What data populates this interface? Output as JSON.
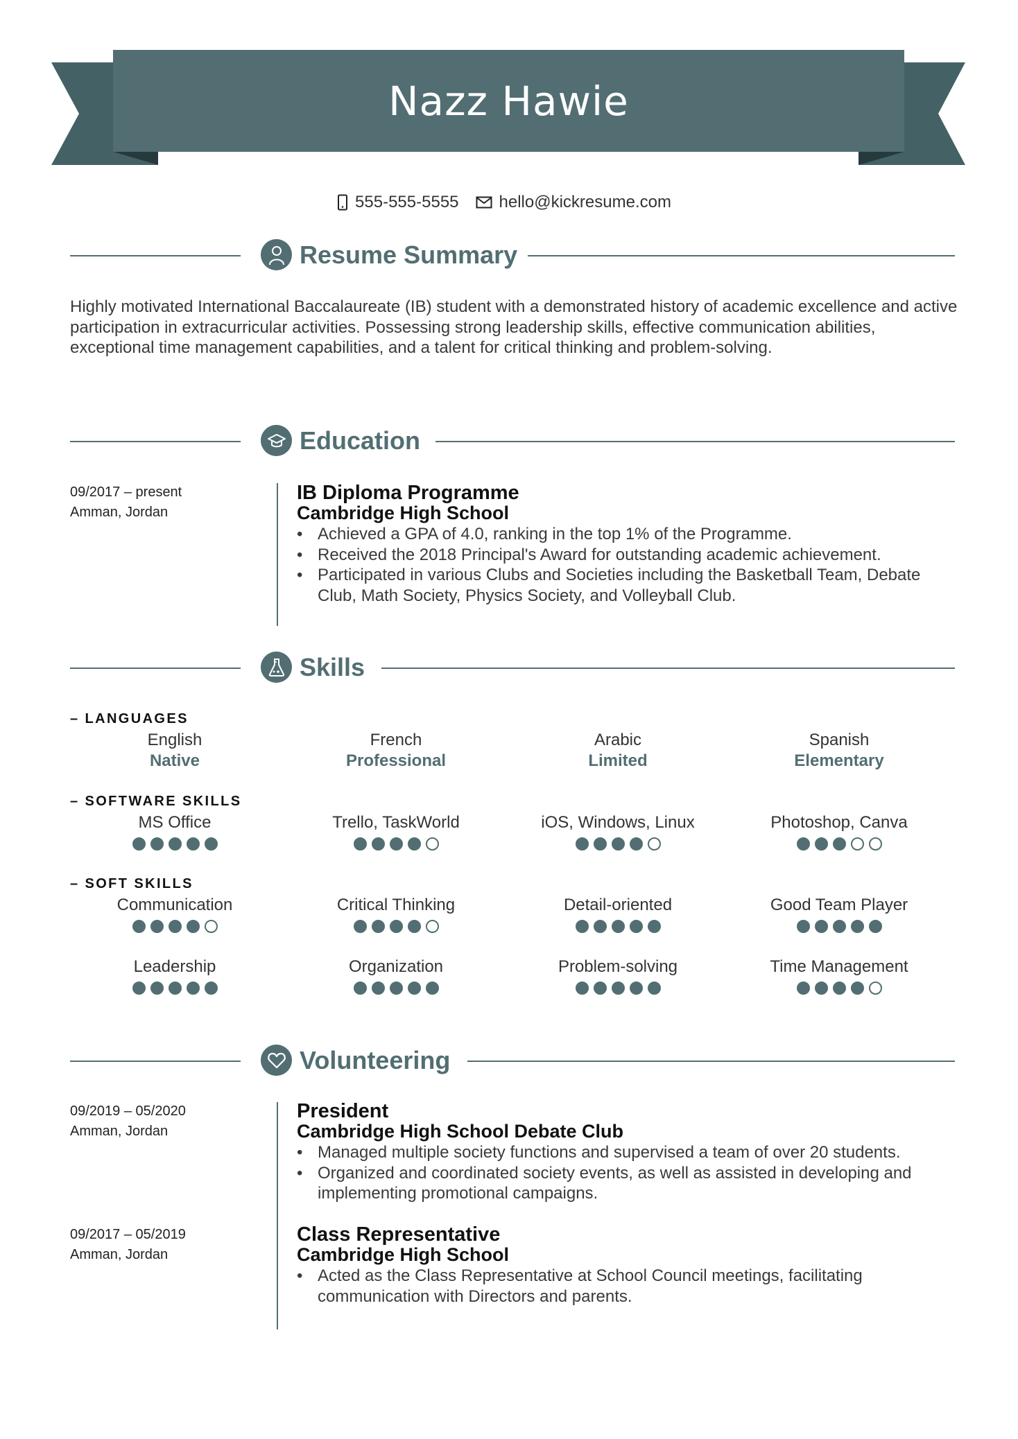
{
  "header": {
    "name": "Nazz Hawie",
    "phone_icon": "phone-icon",
    "phone": "555-555-5555",
    "email_icon": "mail-icon",
    "email": "hello@kickresume.com"
  },
  "colors": {
    "accent": "#526e72",
    "ribbon_tail": "#446266",
    "ribbon_fold": "#263a3d",
    "text": "#333333",
    "heading_text": "#111111"
  },
  "summary": {
    "title": "Resume Summary",
    "icon": "user-icon",
    "text": "Highly motivated International Baccalaureate (IB) student with a demonstrated history of academic excellence and active participation in extracurricular activities. Possessing strong leadership skills, effective communication abilities, exceptional time management capabilities, and a talent for critical thinking and problem-solving."
  },
  "education": {
    "title": "Education",
    "icon": "graduation-cap-icon",
    "entries": [
      {
        "dates": "09/2017 – present",
        "location": "Amman, Jordan",
        "degree": "IB Diploma Programme",
        "school": "Cambridge High School",
        "bullets": [
          "Achieved a GPA of 4.0, ranking in the top 1% of the Programme.",
          "Received the 2018 Principal's Award for outstanding academic achievement.",
          "Participated in various Clubs and Societies including the Basketball Team, Debate Club, Math Society, Physics Society, and Volleyball Club."
        ]
      }
    ]
  },
  "skills": {
    "title": "Skills",
    "icon": "flask-icon",
    "languages": {
      "label": "– LANGUAGES",
      "items": [
        {
          "name": "English",
          "level": "Native"
        },
        {
          "name": "French",
          "level": "Professional"
        },
        {
          "name": "Arabic",
          "level": "Limited"
        },
        {
          "name": "Spanish",
          "level": "Elementary"
        }
      ]
    },
    "software": {
      "label": "– SOFTWARE SKILLS",
      "items": [
        {
          "name": "MS Office",
          "rating": 5,
          "max": 5
        },
        {
          "name": "Trello, TaskWorld",
          "rating": 4,
          "max": 5
        },
        {
          "name": "iOS, Windows, Linux",
          "rating": 4,
          "max": 5
        },
        {
          "name": "Photoshop, Canva",
          "rating": 3,
          "max": 5
        }
      ]
    },
    "soft": {
      "label": "– SOFT SKILLS",
      "items": [
        {
          "name": "Communication",
          "rating": 4,
          "max": 5
        },
        {
          "name": "Critical Thinking",
          "rating": 4,
          "max": 5
        },
        {
          "name": "Detail-oriented",
          "rating": 5,
          "max": 5
        },
        {
          "name": "Good Team Player",
          "rating": 5,
          "max": 5
        },
        {
          "name": "Leadership",
          "rating": 5,
          "max": 5
        },
        {
          "name": "Organization",
          "rating": 5,
          "max": 5
        },
        {
          "name": "Problem-solving",
          "rating": 5,
          "max": 5
        },
        {
          "name": "Time Management",
          "rating": 4,
          "max": 5
        }
      ]
    }
  },
  "volunteering": {
    "title": "Volunteering",
    "icon": "heart-icon",
    "entries": [
      {
        "dates": "09/2019 – 05/2020",
        "location": "Amman, Jordan",
        "role": "President",
        "org": "Cambridge High School Debate Club",
        "bullets": [
          "Managed multiple society functions and supervised a team of over 20 students.",
          "Organized and coordinated society events, as well as assisted in developing and implementing promotional campaigns."
        ]
      },
      {
        "dates": "09/2017 – 05/2019",
        "location": "Amman, Jordan",
        "role": "Class Representative",
        "org": "Cambridge High School",
        "bullets": [
          "Acted as the Class Representative at School Council meetings, facilitating communication with Directors and parents."
        ]
      }
    ]
  }
}
